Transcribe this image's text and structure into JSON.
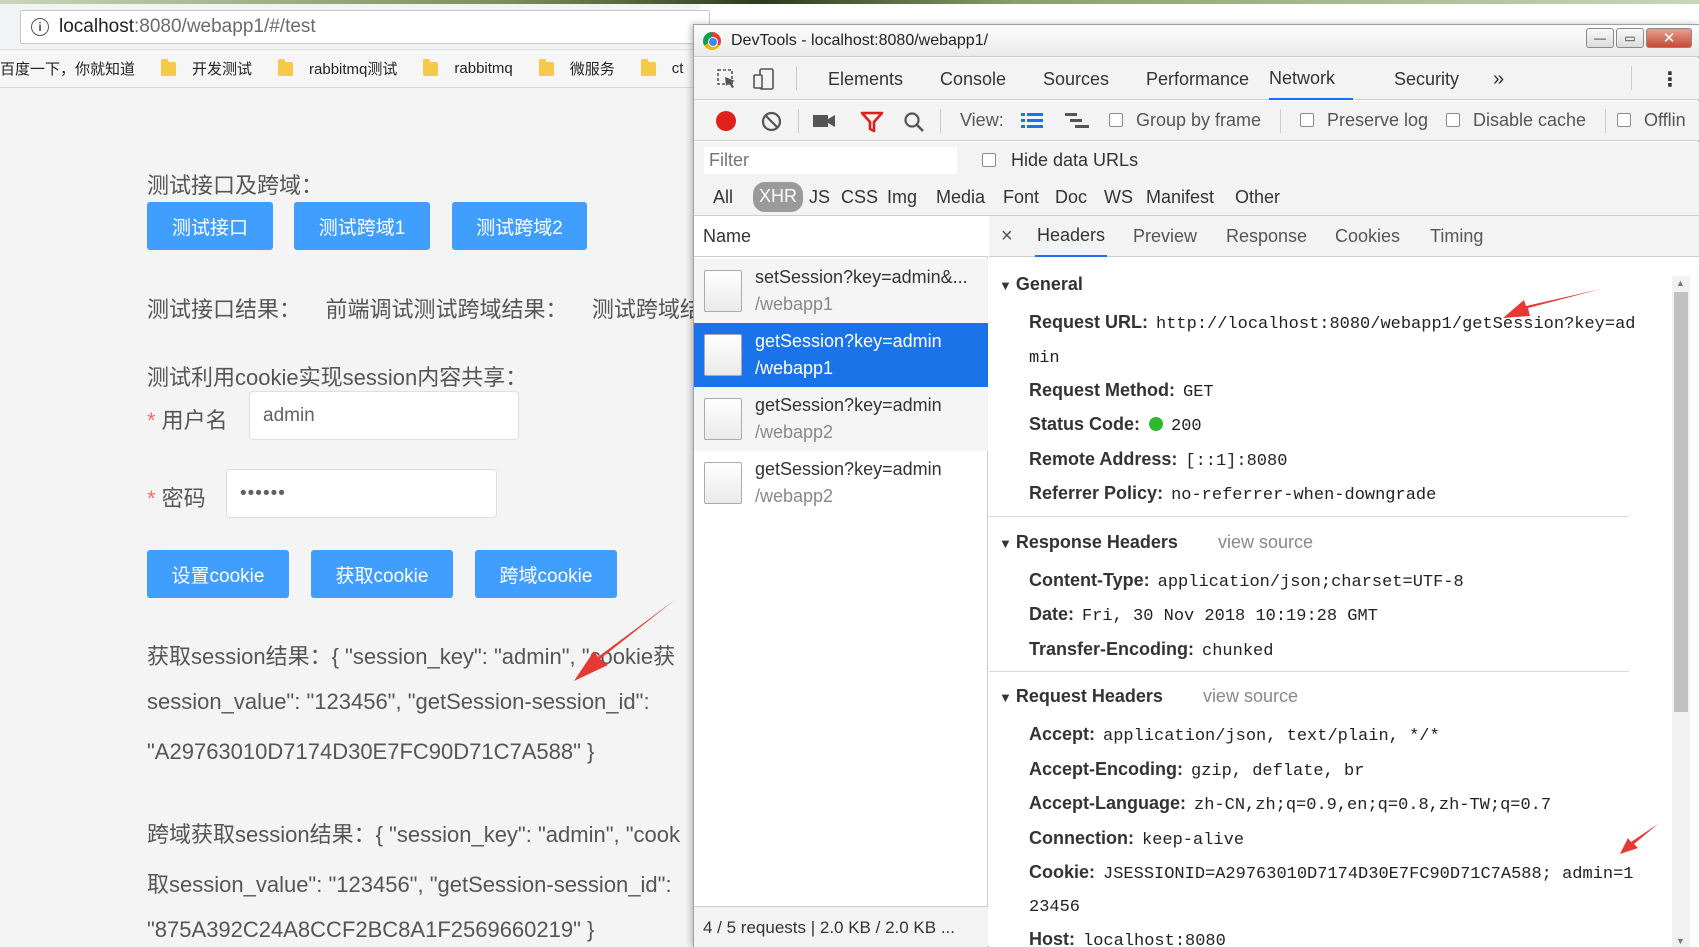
{
  "browser": {
    "url_host": "localhost",
    "url_rest": ":8080/webapp1/#/test",
    "bookmarks": [
      "百度一下，你就知道",
      "开发测试",
      "rabbitmq测试",
      "rabbitmq",
      "微服务",
      "ct"
    ]
  },
  "page": {
    "section1_title": "测试接口及跨域：",
    "btn_test": "测试接口",
    "btn_cross1": "测试跨域1",
    "btn_cross2": "测试跨域2",
    "result_line": "测试接口结果：    前端调试测试跨域结果：    测试跨域结",
    "section2_title": "测试利用cookie实现session内容共享：",
    "required_mark": "*",
    "username_label": "用户名",
    "username_value": "admin",
    "password_label": "密码",
    "password_value": "••••••",
    "btn_set_cookie": "设置cookie",
    "btn_get_cookie": "获取cookie",
    "btn_cross_cookie": "跨域cookie",
    "session_result_1": "获取session结果：{ \"session_key\": \"admin\", \"cookie获",
    "session_result_2": "session_value\": \"123456\", \"getSession-session_id\":",
    "session_result_3": "\"A29763010D7174D30E7FC90D71C7A588\" }",
    "cross_result_1": "跨域获取session结果：{ \"session_key\": \"admin\", \"cook",
    "cross_result_2": "取session_value\": \"123456\", \"getSession-session_id\":",
    "cross_result_3": "\"875A392C24A8CCF2BC8A1F2569660219\" }"
  },
  "devtools": {
    "window_title": "DevTools - localhost:8080/webapp1/",
    "tabs": [
      "Elements",
      "Console",
      "Sources",
      "Performance",
      "Network",
      "Security",
      "»"
    ],
    "active_tab": "Network",
    "toolbar": {
      "view_label": "View:",
      "group_by_frame": "Group by frame",
      "preserve_log": "Preserve log",
      "disable_cache": "Disable cache",
      "offline": "Offlin"
    },
    "filter_placeholder": "Filter",
    "hide_data_urls": "Hide data URLs",
    "types": [
      "All",
      "XHR",
      "JS",
      "CSS",
      "Img",
      "Media",
      "Font",
      "Doc",
      "WS",
      "Manifest",
      "Other"
    ],
    "name_header": "Name",
    "requests": [
      {
        "name": "setSession?key=admin&...",
        "path": "/webapp1"
      },
      {
        "name": "getSession?key=admin",
        "path": "/webapp1"
      },
      {
        "name": "getSession?key=admin",
        "path": "/webapp2"
      },
      {
        "name": "getSession?key=admin",
        "path": "/webapp2"
      }
    ],
    "status_summary": "4 / 5 requests  |  2.0 KB / 2.0 KB ...",
    "detail_close": "×",
    "detail_tabs": [
      "Headers",
      "Preview",
      "Response",
      "Cookies",
      "Timing"
    ],
    "general": {
      "title": "General",
      "request_url_k": "Request URL:",
      "request_url_v1": "http://localhost:8080/webapp1/getSession?key=ad",
      "request_url_v2": "min",
      "method_k": "Request Method:",
      "method_v": "GET",
      "status_k": "Status Code:",
      "status_v": "200",
      "remote_k": "Remote Address:",
      "remote_v": "[::1]:8080",
      "referrer_k": "Referrer Policy:",
      "referrer_v": "no-referrer-when-downgrade"
    },
    "response_headers": {
      "title": "Response Headers",
      "view_source": "view source",
      "ct_k": "Content-Type:",
      "ct_v": "application/json;charset=UTF-8",
      "date_k": "Date:",
      "date_v": "Fri, 30 Nov 2018 10:19:28 GMT",
      "te_k": "Transfer-Encoding:",
      "te_v": "chunked"
    },
    "request_headers": {
      "title": "Request Headers",
      "view_source": "view source",
      "accept_k": "Accept:",
      "accept_v": "application/json, text/plain, */*",
      "ae_k": "Accept-Encoding:",
      "ae_v": "gzip, deflate, br",
      "al_k": "Accept-Language:",
      "al_v": "zh-CN,zh;q=0.9,en;q=0.8,zh-TW;q=0.7",
      "conn_k": "Connection:",
      "conn_v": "keep-alive",
      "cookie_k": "Cookie:",
      "cookie_v1": "JSESSIONID=A29763010D7174D30E7FC90D71C7A588; admin=1",
      "cookie_v2": "23456",
      "host_k": "Host:",
      "host_v": "localhost:8080"
    }
  },
  "colors": {
    "primary_button": "#409eff",
    "selected_row": "#1a73e8",
    "arrow": "#e53935",
    "status_ok": "#2eb82e"
  }
}
